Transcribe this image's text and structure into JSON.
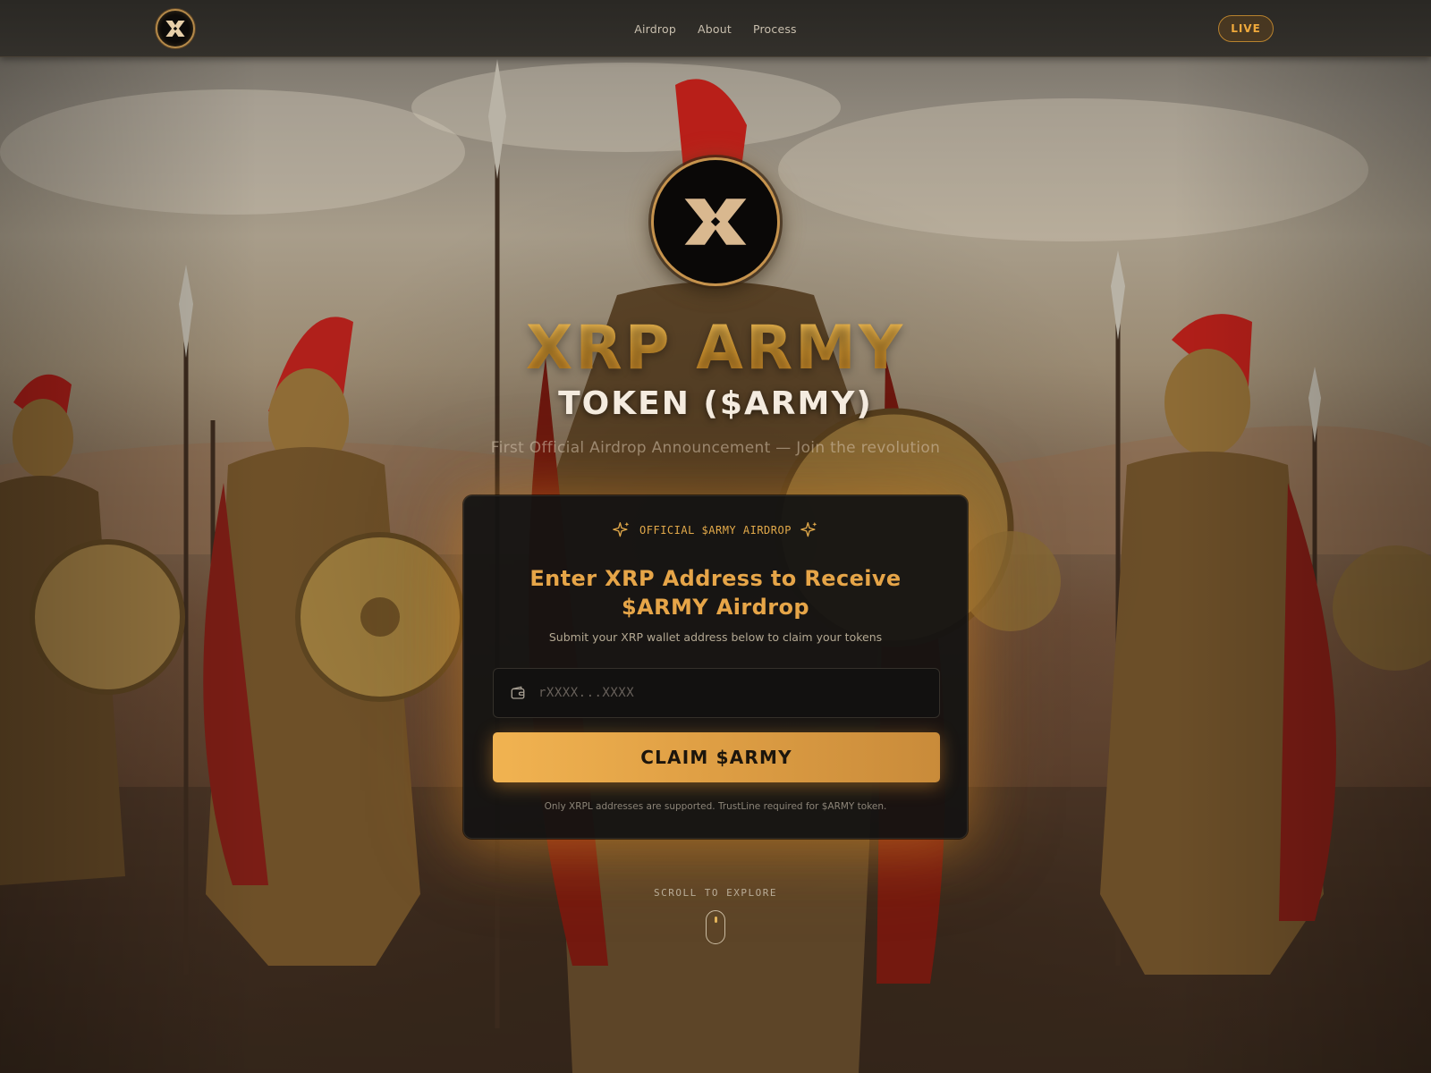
{
  "nav": {
    "links": [
      {
        "label": "Airdrop"
      },
      {
        "label": "About"
      },
      {
        "label": "Process"
      }
    ],
    "live_label": "LIVE",
    "logo_icon": "xrp-army-logo-icon"
  },
  "hero": {
    "title": "XRP ARMY",
    "subtitle": "TOKEN ($ARMY)",
    "tagline": "First Official Airdrop Announcement — Join the revolution"
  },
  "claim": {
    "eyebrow": "OFFICIAL $ARMY AIRDROP",
    "heading": "Enter XRP Address to Receive $ARMY Airdrop",
    "description": "Submit your XRP wallet address below to claim your tokens",
    "input_placeholder": "rXXXX...XXXX",
    "input_value": "",
    "button_label": "CLAIM $ARMY",
    "note": "Only XRPL addresses are supported. TrustLine required for $ARMY token."
  },
  "scroll": {
    "label": "SCROLL TO EXPLORE"
  },
  "colors": {
    "accent": "#e6a548",
    "live": "#f0a93b",
    "nav_bg": "#2f2c28",
    "card_bg": "#141312"
  }
}
